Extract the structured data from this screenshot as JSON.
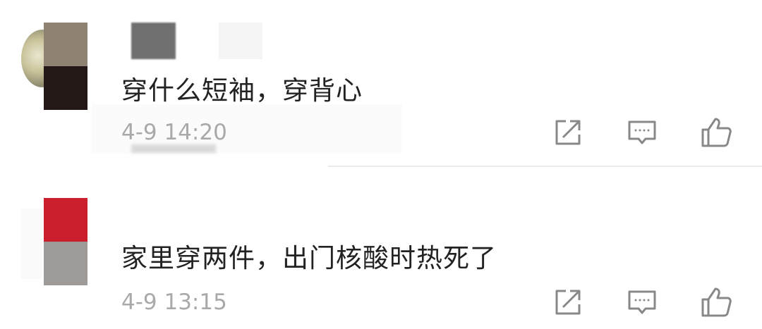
{
  "comments": [
    {
      "text": "穿什么短袖，穿背心",
      "time": "4-9 14:20",
      "actions": {
        "share_icon": "share-icon",
        "reply_icon": "comment-icon",
        "like_icon": "thumbs-up-icon"
      }
    },
    {
      "text": "家里穿两件，出门核酸时热死了",
      "time": "4-9 13:15",
      "actions": {
        "share_icon": "share-icon",
        "reply_icon": "comment-icon",
        "like_icon": "thumbs-up-icon"
      }
    }
  ],
  "colors": {
    "text": "#222222",
    "time": "#a9a9a9",
    "icon": "#888888",
    "divider": "#ececec"
  }
}
